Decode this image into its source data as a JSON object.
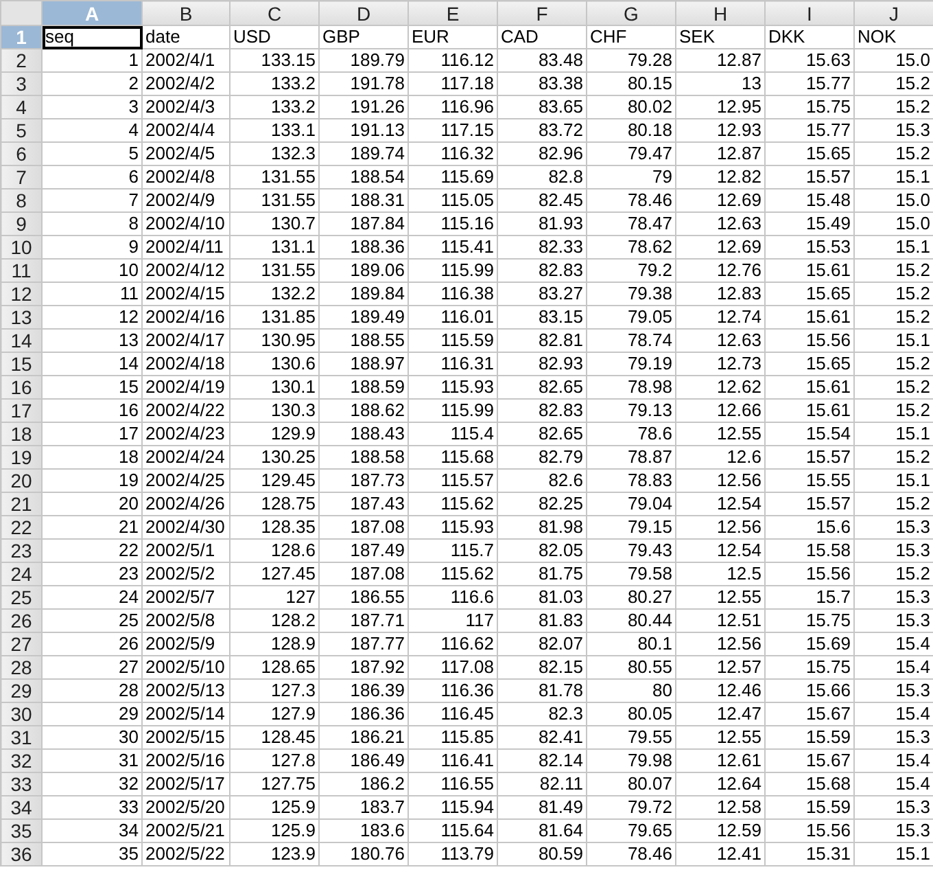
{
  "columns": [
    {
      "label": "A",
      "selected": true,
      "kind": "number"
    },
    {
      "label": "B",
      "selected": false,
      "kind": "text"
    },
    {
      "label": "C",
      "selected": false,
      "kind": "number"
    },
    {
      "label": "D",
      "selected": false,
      "kind": "number"
    },
    {
      "label": "E",
      "selected": false,
      "kind": "number"
    },
    {
      "label": "F",
      "selected": false,
      "kind": "number"
    },
    {
      "label": "G",
      "selected": false,
      "kind": "number"
    },
    {
      "label": "H",
      "selected": false,
      "kind": "number"
    },
    {
      "label": "I",
      "selected": false,
      "kind": "number"
    },
    {
      "label": "J",
      "selected": false,
      "kind": "number"
    }
  ],
  "rows": [
    {
      "number": "1",
      "selected": true,
      "kind": "header",
      "cells": [
        "seq",
        "date",
        "USD",
        "GBP",
        "EUR",
        "CAD",
        "CHF",
        "SEK",
        "DKK",
        "NOK"
      ]
    },
    {
      "number": "2",
      "selected": false,
      "kind": "data",
      "cells": [
        "1",
        "2002/4/1",
        "133.15",
        "189.79",
        "116.12",
        "83.48",
        "79.28",
        "12.87",
        "15.63",
        "15.0"
      ]
    },
    {
      "number": "3",
      "selected": false,
      "kind": "data",
      "cells": [
        "2",
        "2002/4/2",
        "133.2",
        "191.78",
        "117.18",
        "83.38",
        "80.15",
        "13",
        "15.77",
        "15.2"
      ]
    },
    {
      "number": "4",
      "selected": false,
      "kind": "data",
      "cells": [
        "3",
        "2002/4/3",
        "133.2",
        "191.26",
        "116.96",
        "83.65",
        "80.02",
        "12.95",
        "15.75",
        "15.2"
      ]
    },
    {
      "number": "5",
      "selected": false,
      "kind": "data",
      "cells": [
        "4",
        "2002/4/4",
        "133.1",
        "191.13",
        "117.15",
        "83.72",
        "80.18",
        "12.93",
        "15.77",
        "15.3"
      ]
    },
    {
      "number": "6",
      "selected": false,
      "kind": "data",
      "cells": [
        "5",
        "2002/4/5",
        "132.3",
        "189.74",
        "116.32",
        "82.96",
        "79.47",
        "12.87",
        "15.65",
        "15.2"
      ]
    },
    {
      "number": "7",
      "selected": false,
      "kind": "data",
      "cells": [
        "6",
        "2002/4/8",
        "131.55",
        "188.54",
        "115.69",
        "82.8",
        "79",
        "12.82",
        "15.57",
        "15.1"
      ]
    },
    {
      "number": "8",
      "selected": false,
      "kind": "data",
      "cells": [
        "7",
        "2002/4/9",
        "131.55",
        "188.31",
        "115.05",
        "82.45",
        "78.46",
        "12.69",
        "15.48",
        "15.0"
      ]
    },
    {
      "number": "9",
      "selected": false,
      "kind": "data",
      "cells": [
        "8",
        "2002/4/10",
        "130.7",
        "187.84",
        "115.16",
        "81.93",
        "78.47",
        "12.63",
        "15.49",
        "15.0"
      ]
    },
    {
      "number": "10",
      "selected": false,
      "kind": "data",
      "cells": [
        "9",
        "2002/4/11",
        "131.1",
        "188.36",
        "115.41",
        "82.33",
        "78.62",
        "12.69",
        "15.53",
        "15.1"
      ]
    },
    {
      "number": "11",
      "selected": false,
      "kind": "data",
      "cells": [
        "10",
        "2002/4/12",
        "131.55",
        "189.06",
        "115.99",
        "82.83",
        "79.2",
        "12.76",
        "15.61",
        "15.2"
      ]
    },
    {
      "number": "12",
      "selected": false,
      "kind": "data",
      "cells": [
        "11",
        "2002/4/15",
        "132.2",
        "189.84",
        "116.38",
        "83.27",
        "79.38",
        "12.83",
        "15.65",
        "15.2"
      ]
    },
    {
      "number": "13",
      "selected": false,
      "kind": "data",
      "cells": [
        "12",
        "2002/4/16",
        "131.85",
        "189.49",
        "116.01",
        "83.15",
        "79.05",
        "12.74",
        "15.61",
        "15.2"
      ]
    },
    {
      "number": "14",
      "selected": false,
      "kind": "data",
      "cells": [
        "13",
        "2002/4/17",
        "130.95",
        "188.55",
        "115.59",
        "82.81",
        "78.74",
        "12.63",
        "15.56",
        "15.1"
      ]
    },
    {
      "number": "15",
      "selected": false,
      "kind": "data",
      "cells": [
        "14",
        "2002/4/18",
        "130.6",
        "188.97",
        "116.31",
        "82.93",
        "79.19",
        "12.73",
        "15.65",
        "15.2"
      ]
    },
    {
      "number": "16",
      "selected": false,
      "kind": "data",
      "cells": [
        "15",
        "2002/4/19",
        "130.1",
        "188.59",
        "115.93",
        "82.65",
        "78.98",
        "12.62",
        "15.61",
        "15.2"
      ]
    },
    {
      "number": "17",
      "selected": false,
      "kind": "data",
      "cells": [
        "16",
        "2002/4/22",
        "130.3",
        "188.62",
        "115.99",
        "82.83",
        "79.13",
        "12.66",
        "15.61",
        "15.2"
      ]
    },
    {
      "number": "18",
      "selected": false,
      "kind": "data",
      "cells": [
        "17",
        "2002/4/23",
        "129.9",
        "188.43",
        "115.4",
        "82.65",
        "78.6",
        "12.55",
        "15.54",
        "15.1"
      ]
    },
    {
      "number": "19",
      "selected": false,
      "kind": "data",
      "cells": [
        "18",
        "2002/4/24",
        "130.25",
        "188.58",
        "115.68",
        "82.79",
        "78.87",
        "12.6",
        "15.57",
        "15.2"
      ]
    },
    {
      "number": "20",
      "selected": false,
      "kind": "data",
      "cells": [
        "19",
        "2002/4/25",
        "129.45",
        "187.73",
        "115.57",
        "82.6",
        "78.83",
        "12.56",
        "15.55",
        "15.1"
      ]
    },
    {
      "number": "21",
      "selected": false,
      "kind": "data",
      "cells": [
        "20",
        "2002/4/26",
        "128.75",
        "187.43",
        "115.62",
        "82.25",
        "79.04",
        "12.54",
        "15.57",
        "15.2"
      ]
    },
    {
      "number": "22",
      "selected": false,
      "kind": "data",
      "cells": [
        "21",
        "2002/4/30",
        "128.35",
        "187.08",
        "115.93",
        "81.98",
        "79.15",
        "12.56",
        "15.6",
        "15.3"
      ]
    },
    {
      "number": "23",
      "selected": false,
      "kind": "data",
      "cells": [
        "22",
        "2002/5/1",
        "128.6",
        "187.49",
        "115.7",
        "82.05",
        "79.43",
        "12.54",
        "15.58",
        "15.3"
      ]
    },
    {
      "number": "24",
      "selected": false,
      "kind": "data",
      "cells": [
        "23",
        "2002/5/2",
        "127.45",
        "187.08",
        "115.62",
        "81.75",
        "79.58",
        "12.5",
        "15.56",
        "15.2"
      ]
    },
    {
      "number": "25",
      "selected": false,
      "kind": "data",
      "cells": [
        "24",
        "2002/5/7",
        "127",
        "186.55",
        "116.6",
        "81.03",
        "80.27",
        "12.55",
        "15.7",
        "15.3"
      ]
    },
    {
      "number": "26",
      "selected": false,
      "kind": "data",
      "cells": [
        "25",
        "2002/5/8",
        "128.2",
        "187.71",
        "117",
        "81.83",
        "80.44",
        "12.51",
        "15.75",
        "15.3"
      ]
    },
    {
      "number": "27",
      "selected": false,
      "kind": "data",
      "cells": [
        "26",
        "2002/5/9",
        "128.9",
        "187.77",
        "116.62",
        "82.07",
        "80.1",
        "12.56",
        "15.69",
        "15.4"
      ]
    },
    {
      "number": "28",
      "selected": false,
      "kind": "data",
      "cells": [
        "27",
        "2002/5/10",
        "128.65",
        "187.92",
        "117.08",
        "82.15",
        "80.55",
        "12.57",
        "15.75",
        "15.4"
      ]
    },
    {
      "number": "29",
      "selected": false,
      "kind": "data",
      "cells": [
        "28",
        "2002/5/13",
        "127.3",
        "186.39",
        "116.36",
        "81.78",
        "80",
        "12.46",
        "15.66",
        "15.3"
      ]
    },
    {
      "number": "30",
      "selected": false,
      "kind": "data",
      "cells": [
        "29",
        "2002/5/14",
        "127.9",
        "186.36",
        "116.45",
        "82.3",
        "80.05",
        "12.47",
        "15.67",
        "15.4"
      ]
    },
    {
      "number": "31",
      "selected": false,
      "kind": "data",
      "cells": [
        "30",
        "2002/5/15",
        "128.45",
        "186.21",
        "115.85",
        "82.41",
        "79.55",
        "12.55",
        "15.59",
        "15.3"
      ]
    },
    {
      "number": "32",
      "selected": false,
      "kind": "data",
      "cells": [
        "31",
        "2002/5/16",
        "127.8",
        "186.49",
        "116.41",
        "82.14",
        "79.98",
        "12.61",
        "15.67",
        "15.4"
      ]
    },
    {
      "number": "33",
      "selected": false,
      "kind": "data",
      "cells": [
        "32",
        "2002/5/17",
        "127.75",
        "186.2",
        "116.55",
        "82.11",
        "80.07",
        "12.64",
        "15.68",
        "15.4"
      ]
    },
    {
      "number": "34",
      "selected": false,
      "kind": "data",
      "cells": [
        "33",
        "2002/5/20",
        "125.9",
        "183.7",
        "115.94",
        "81.49",
        "79.72",
        "12.58",
        "15.59",
        "15.3"
      ]
    },
    {
      "number": "35",
      "selected": false,
      "kind": "data",
      "cells": [
        "34",
        "2002/5/21",
        "125.9",
        "183.6",
        "115.64",
        "81.64",
        "79.65",
        "12.59",
        "15.56",
        "15.3"
      ]
    },
    {
      "number": "36",
      "selected": false,
      "kind": "data",
      "cells": [
        "35",
        "2002/5/22",
        "123.9",
        "180.76",
        "113.79",
        "80.59",
        "78.46",
        "12.41",
        "15.31",
        "15.1"
      ]
    }
  ]
}
